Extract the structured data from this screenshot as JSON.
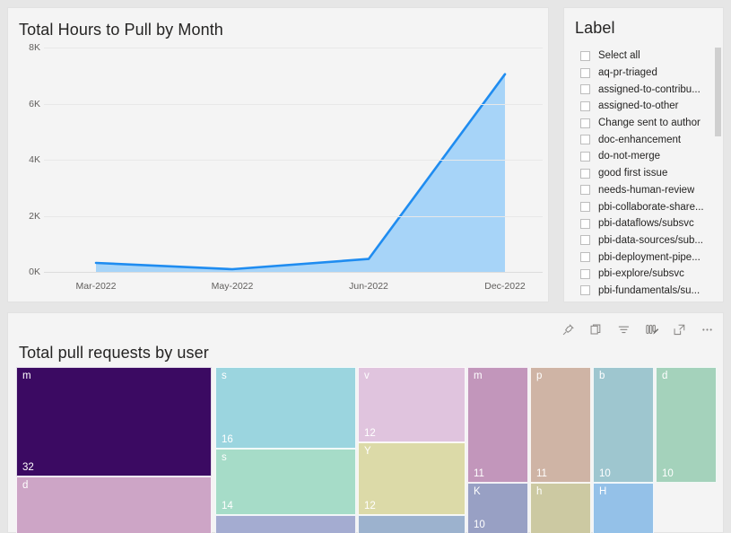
{
  "chart_card": {
    "title": "Total Hours to Pull by Month"
  },
  "chart_data": {
    "type": "area",
    "title": "Total Hours to Pull by Month",
    "xlabel": "",
    "ylabel": "",
    "categories": [
      "Mar-2022",
      "May-2022",
      "Jun-2022",
      "Dec-2022"
    ],
    "values": [
      320,
      95,
      460,
      7050
    ],
    "ylim": [
      0,
      8000
    ],
    "yticks": [
      "0K",
      "2K",
      "4K",
      "6K",
      "8K"
    ],
    "ytick_values": [
      0,
      2000,
      4000,
      6000,
      8000
    ],
    "grid": true,
    "legend": "none",
    "line_color": "#1f8cf0",
    "fill_color": "#a2d2f8"
  },
  "label_card": {
    "title": "Label",
    "items": [
      {
        "label": "Select all",
        "checked": false
      },
      {
        "label": "aq-pr-triaged",
        "checked": false
      },
      {
        "label": "assigned-to-contribu...",
        "checked": false
      },
      {
        "label": "assigned-to-other",
        "checked": false
      },
      {
        "label": "Change sent to author",
        "checked": false
      },
      {
        "label": "doc-enhancement",
        "checked": false
      },
      {
        "label": "do-not-merge",
        "checked": false
      },
      {
        "label": "good first issue",
        "checked": false
      },
      {
        "label": "needs-human-review",
        "checked": false
      },
      {
        "label": "pbi-collaborate-share...",
        "checked": false
      },
      {
        "label": "pbi-dataflows/subsvc",
        "checked": false
      },
      {
        "label": "pbi-data-sources/sub...",
        "checked": false
      },
      {
        "label": "pbi-deployment-pipe...",
        "checked": false
      },
      {
        "label": "pbi-explore/subsvc",
        "checked": false
      },
      {
        "label": "pbi-fundamentals/su...",
        "checked": false
      }
    ]
  },
  "tree_card": {
    "title": "Total pull requests by user",
    "toolbar": [
      {
        "name": "pin-icon",
        "tooltip": "Pin to dashboard"
      },
      {
        "name": "copy-icon",
        "tooltip": "Copy visual"
      },
      {
        "name": "filter-icon",
        "tooltip": "Filters"
      },
      {
        "name": "personalize-visual-icon",
        "tooltip": "Personalize this visual"
      },
      {
        "name": "focus-mode-icon",
        "tooltip": "Focus mode"
      },
      {
        "name": "more-options-icon",
        "tooltip": "More options"
      }
    ]
  },
  "treemap_data": {
    "type": "treemap",
    "title": "Total pull requests by user",
    "tiles": [
      {
        "category": "m",
        "value": "32",
        "color": "#3b0a62"
      },
      {
        "category": "d",
        "value": "",
        "color": "#cda5c6"
      },
      {
        "category": "s",
        "value": "16",
        "color": "#9bd5df"
      },
      {
        "category": "s",
        "value": "14",
        "color": "#a6dcc8"
      },
      {
        "category": "",
        "value": "",
        "color": "#a4acd1"
      },
      {
        "category": "v",
        "value": "12",
        "color": "#e0c4de"
      },
      {
        "category": "Y",
        "value": "12",
        "color": "#dcdaa8"
      },
      {
        "category": "",
        "value": "",
        "color": "#9cb2ce"
      },
      {
        "category": "m",
        "value": "11",
        "color": "#c296bb"
      },
      {
        "category": "K",
        "value": "10",
        "color": "#98a0c4"
      },
      {
        "category": "p",
        "value": "11",
        "color": "#cfb4a5"
      },
      {
        "category": "h",
        "value": "",
        "color": "#ccc9a2"
      },
      {
        "category": "b",
        "value": "10",
        "color": "#9ec6cf"
      },
      {
        "category": "H",
        "value": "",
        "color": "#94c1e8"
      },
      {
        "category": "d",
        "value": "10",
        "color": "#a4d2bb"
      }
    ]
  }
}
